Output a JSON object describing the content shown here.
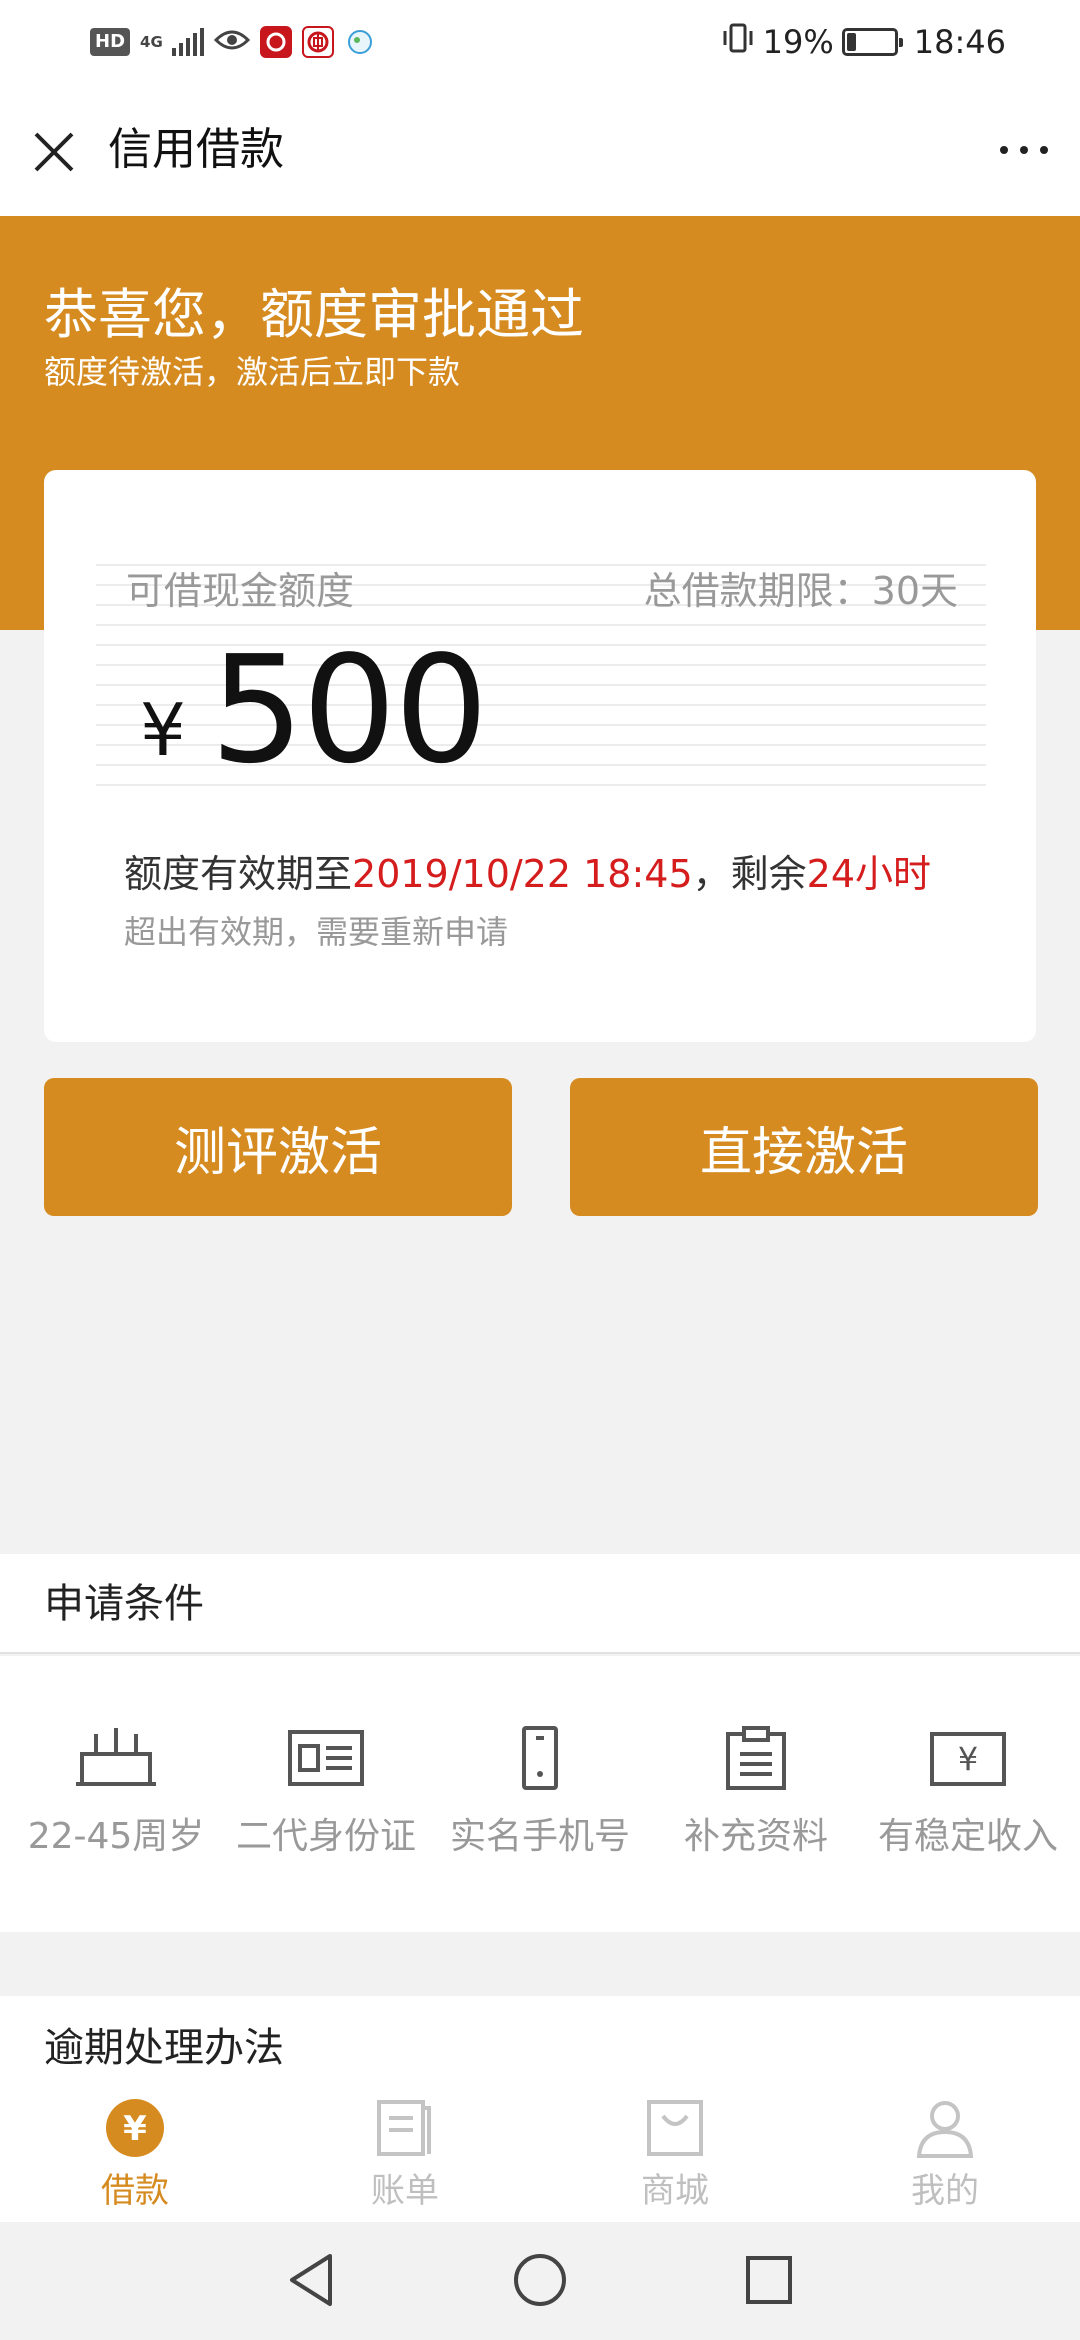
{
  "status_bar": {
    "hd": "HD",
    "network": "4G",
    "battery": "19%",
    "battery_level": 0.19,
    "time": "18:46"
  },
  "nav": {
    "title": "信用借款",
    "close_icon": "close-icon",
    "more_icon": "more-icon"
  },
  "banner": {
    "title": "恭喜您，额度审批通过",
    "subtitle": "额度待激活，激活后立即下款"
  },
  "card": {
    "amount_label": "可借现金额度",
    "term_label": "总借款期限：30天",
    "currency": "¥",
    "amount": "500",
    "valid_prefix": "额度有效期至",
    "valid_date": "2019/10/22 18:45",
    "valid_mid": "，剩余",
    "valid_remaining": "24小时",
    "expire_note": "超出有效期，需要重新申请"
  },
  "buttons": {
    "evaluate": "测评激活",
    "direct": "直接激活"
  },
  "conditions": {
    "title": "申请条件",
    "items": [
      {
        "label": "22-45周岁",
        "icon": "cake-icon"
      },
      {
        "label": "二代身份证",
        "icon": "id-card-icon"
      },
      {
        "label": "实名手机号",
        "icon": "phone-icon"
      },
      {
        "label": "补充资料",
        "icon": "clipboard-icon"
      },
      {
        "label": "有稳定收入",
        "icon": "income-icon"
      }
    ]
  },
  "overdue": {
    "title": "逾期处理办法"
  },
  "tabs": [
    {
      "label": "借款",
      "icon": "yen-icon",
      "active": true
    },
    {
      "label": "账单",
      "icon": "bill-icon",
      "active": false
    },
    {
      "label": "商城",
      "icon": "shop-bag-icon",
      "active": false
    },
    {
      "label": "我的",
      "icon": "user-icon",
      "active": false
    }
  ],
  "colors": {
    "accent": "#d68b20",
    "highlight_red": "#d51d1d",
    "muted_text": "#999999",
    "background": "#f2f2f2"
  }
}
